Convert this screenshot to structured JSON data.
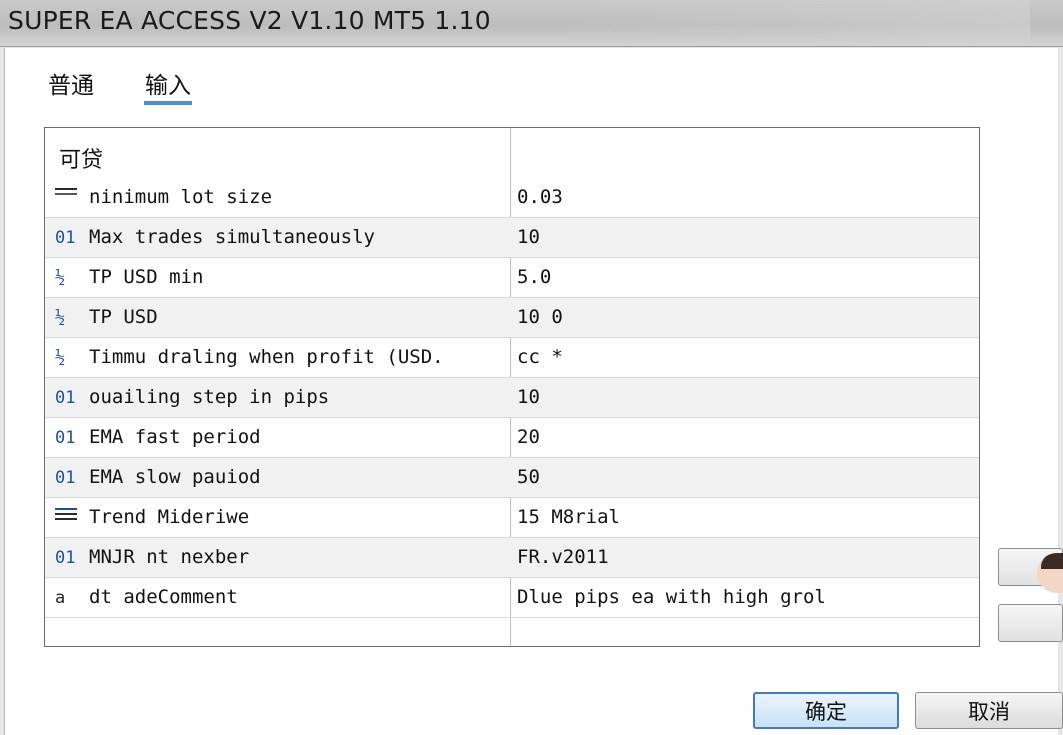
{
  "window": {
    "title": "SUPER EA ACCESS V2 V1.10 MT5 1.10"
  },
  "tabs": [
    {
      "label": "普通"
    },
    {
      "label": "输入"
    }
  ],
  "grid": {
    "group_label": "可贷",
    "rows": [
      {
        "icon": "lines-icon",
        "name": "ninimum lot size",
        "value": "0.03"
      },
      {
        "icon": "int-icon",
        "icon_text": "01",
        "name": "Max trades simultaneously",
        "value": "10"
      },
      {
        "icon": "double-icon",
        "icon_text": "½",
        "name": "TP USD min",
        "value": "5.0"
      },
      {
        "icon": "double-icon",
        "icon_text": "½",
        "name": "TP USD",
        "value": "10 0"
      },
      {
        "icon": "double-icon",
        "icon_text": "½",
        "name": "Timmu draling when profit (USD.",
        "value": "cc *"
      },
      {
        "icon": "int-icon",
        "icon_text": "01",
        "name": "ouailing step in pips",
        "value": "10"
      },
      {
        "icon": "int-icon",
        "icon_text": "01",
        "name": "EMA fast period",
        "value": "20"
      },
      {
        "icon": "int-icon",
        "icon_text": "01",
        "name": "EMA slow pauiod",
        "value": "50"
      },
      {
        "icon": "enum-icon",
        "name": "Trend Mideriwe",
        "value": "15 M8rial"
      },
      {
        "icon": "int-icon",
        "icon_text": "01",
        "name": "MNJR nt nexber",
        "value": "FR.v2011"
      },
      {
        "icon": "string-icon",
        "icon_text": "a",
        "name": "dt adeComment",
        "value": "Dlue pips ea with high grol"
      }
    ]
  },
  "buttons": {
    "ok": "确定",
    "cancel": "取消"
  }
}
